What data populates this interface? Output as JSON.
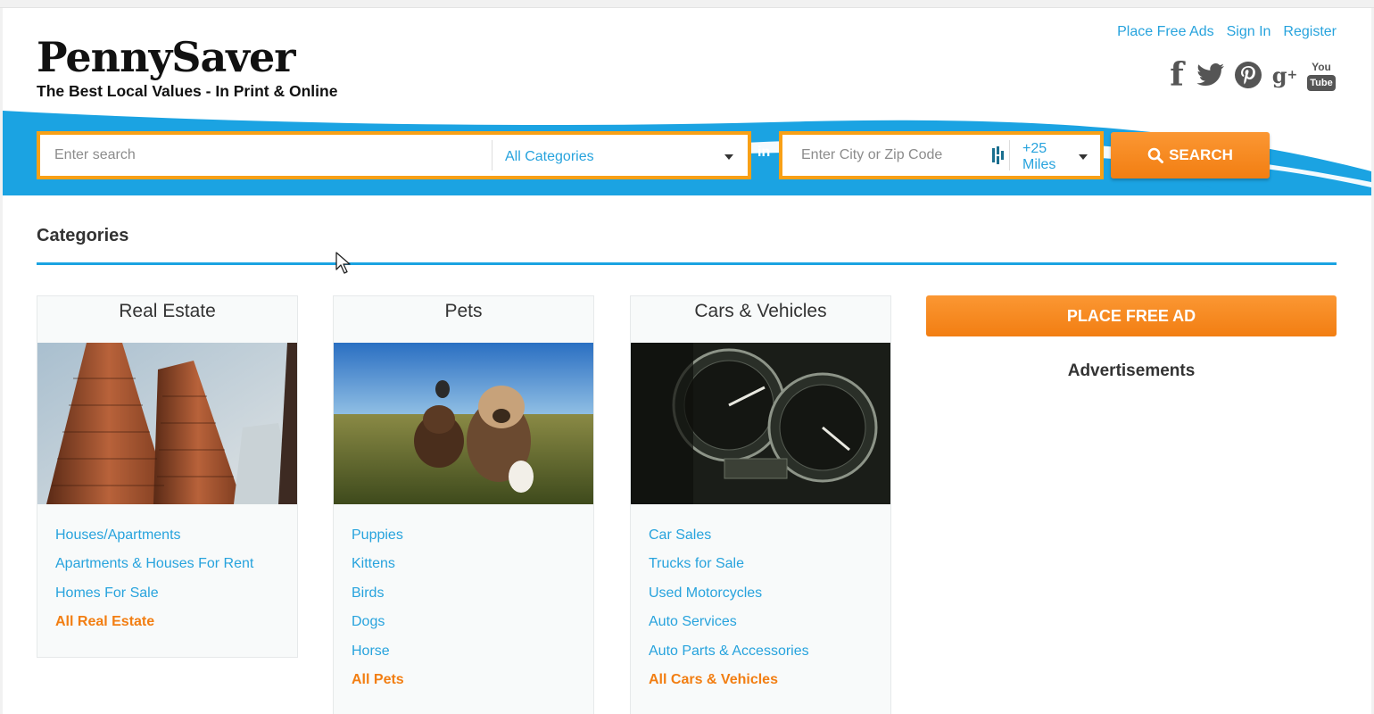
{
  "header": {
    "logo_text": "PennySaver",
    "tagline": "The Best Local Values - In Print & Online",
    "top_links": [
      "Place Free Ads",
      "Sign In",
      "Register"
    ],
    "social_icons": [
      "facebook-icon",
      "twitter-icon",
      "pinterest-icon",
      "google-plus-icon",
      "youtube-icon"
    ],
    "youtube_text_top": "You",
    "youtube_text_bottom": "Tube"
  },
  "search": {
    "query_placeholder": "Enter search",
    "category_value": "All Categories",
    "in_label": "in",
    "location_placeholder": "Enter City or Zip Code",
    "radius_value": "+25 Miles",
    "button_label": "SEARCH"
  },
  "categories": {
    "heading": "Categories",
    "cards": [
      {
        "title": "Real Estate",
        "links": [
          "Houses/Apartments",
          "Apartments & Houses For Rent",
          "Homes For Sale"
        ],
        "all_link": "All Real Estate"
      },
      {
        "title": "Pets",
        "links": [
          "Puppies",
          "Kittens",
          "Birds",
          "Dogs",
          "Horse"
        ],
        "all_link": "All Pets"
      },
      {
        "title": "Cars & Vehicles",
        "links": [
          "Car Sales",
          "Trucks for Sale",
          "Used Motorcycles",
          "Auto Services",
          "Auto Parts & Accessories"
        ],
        "all_link": "All Cars & Vehicles"
      }
    ]
  },
  "sidebar": {
    "place_ad_label": "PLACE FREE AD",
    "ads_label": "Advertisements"
  },
  "colors": {
    "accent_blue": "#27a3dd",
    "accent_orange": "#f27e12",
    "border_orange": "#f8a016",
    "band_blue": "#1ba3e2"
  }
}
